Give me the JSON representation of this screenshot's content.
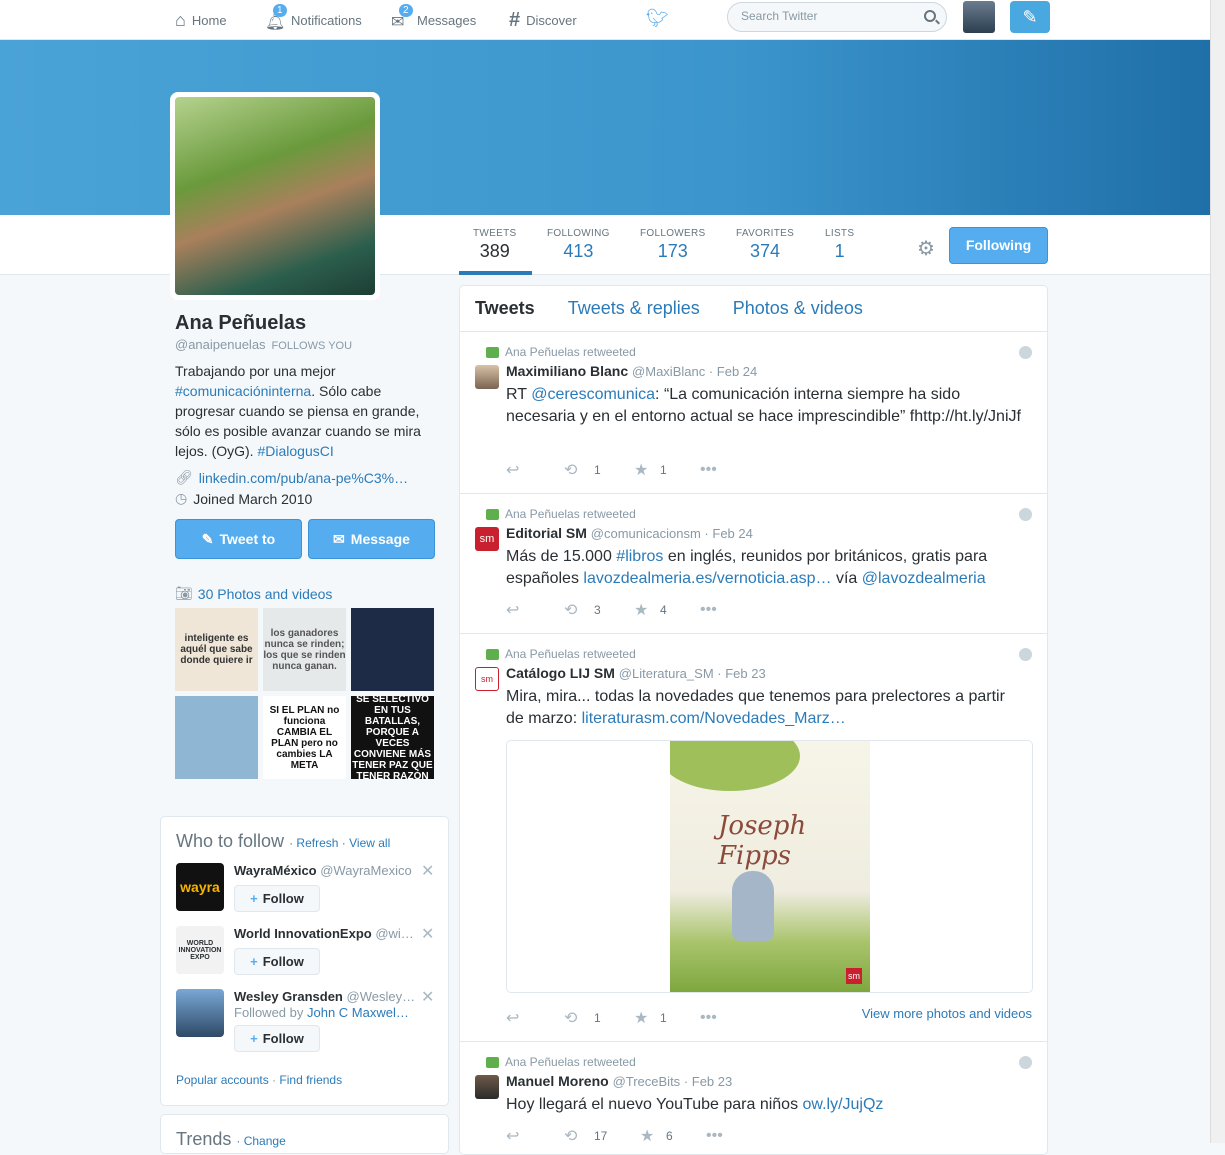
{
  "nav": {
    "home": "Home",
    "notifications": "Notifications",
    "notifications_count": "1",
    "messages": "Messages",
    "messages_count": "2",
    "discover": "Discover",
    "search_placeholder": "Search Twitter"
  },
  "stats": {
    "tweets_label": "TWEETS",
    "tweets": "389",
    "following_label": "FOLLOWING",
    "following": "413",
    "followers_label": "FOLLOWERS",
    "followers": "173",
    "favorites_label": "FAVORITES",
    "favorites": "374",
    "lists_label": "LISTS",
    "lists": "1",
    "following_button": "Following"
  },
  "profile": {
    "name": "Ana Peñuelas",
    "handle": "@anaipenuelas",
    "follows_you": "FOLLOWS YOU",
    "bio_1": "Trabajando por una mejor ",
    "bio_hashtag": "#comunicacióninterna",
    "bio_2": ". Sólo cabe progresar cuando se piensa en grande, sólo es posible avanzar cuando se mira lejos. (OyG). ",
    "bio_hashtag2": "#DialogusCI",
    "link": "linkedin.com/pub/ana-pe%C3%…",
    "joined": "Joined March 2010",
    "tweet_to": "Tweet to",
    "message": "Message",
    "photos_label": "30 Photos and videos"
  },
  "thumbs": [
    {
      "text": "inteligente es aquél que sabe donde quiere ir",
      "bg": "#efe6d8",
      "fg": "#333"
    },
    {
      "text": "los ganadores nunca se rinden; los que se rinden nunca ganan.",
      "bg": "#e6e9ea",
      "fg": "#555"
    },
    {
      "text": "",
      "bg": "#1d2b47",
      "fg": "#fff"
    },
    {
      "text": "",
      "bg": "#8fb7d4",
      "fg": "#fff"
    },
    {
      "text": "SI EL PLAN no funciona CAMBIA EL PLAN pero no cambies LA META",
      "bg": "#ffffff",
      "fg": "#111"
    },
    {
      "text": "SÉ SELECTIVO EN TUS BATALLAS, PORQUE A VECES CONVIENE MÁS TENER PAZ QUE TENER RAZÓN",
      "bg": "#111111",
      "fg": "#fff"
    }
  ],
  "who_to_follow": {
    "title": "Who to follow",
    "refresh": "Refresh",
    "view_all": "View all",
    "follow_label": "Follow",
    "items": [
      {
        "name": "WayraMéxico",
        "handle": "@WayraMexico",
        "sub": ""
      },
      {
        "name": "World InnovationExpo",
        "handle": "@wi…",
        "sub": ""
      },
      {
        "name": "Wesley Gransden",
        "handle": "@Wesley…",
        "sub_prefix": "Followed by ",
        "sub_link": "John C Maxwel…"
      }
    ],
    "popular": "Popular accounts",
    "find_friends": "Find friends"
  },
  "trends": {
    "title": "Trends",
    "change": "Change"
  },
  "tabs": {
    "tweets": "Tweets",
    "replies": "Tweets & replies",
    "photos": "Photos & videos"
  },
  "tweets": [
    {
      "retweeted_by": "Ana Peñuelas retweeted",
      "name": "Maximiliano Blanc",
      "handle": "@MaxiBlanc",
      "date": "Feb 24",
      "text_prefix": "RT ",
      "mention": "@cerescomunica",
      "text": ": “La comunicación interna siempre ha sido necesaria y en el entorno actual se hace imprescindible” fhttp://ht.ly/JniJf",
      "retweets": "1",
      "favorites": "1"
    },
    {
      "retweeted_by": "Ana Peñuelas retweeted",
      "name": "Editorial SM",
      "handle": "@comunicacionsm",
      "date": "Feb 24",
      "text_1": "Más de 15.000 ",
      "hashtag": "#libros",
      "text_2": " en inglés, reunidos por británicos, gratis para españoles ",
      "link": "lavozdealmeria.es/vernoticia.asp…",
      "text_3": " vía ",
      "mention": "@lavozdealmeria",
      "retweets": "3",
      "favorites": "4"
    },
    {
      "retweeted_by": "Ana Peñuelas retweeted",
      "name": "Catálogo LIJ SM",
      "handle": "@Literatura_SM",
      "date": "Feb 23",
      "text": "Mira, mira... todas la novedades que tenemos para prelectores a partir de marzo: ",
      "link": "literaturasm.com/Novedades_Marz…",
      "book_title": "Joseph Fipps",
      "retweets": "1",
      "favorites": "1",
      "view_more": "View more photos and videos"
    },
    {
      "retweeted_by": "Ana Peñuelas retweeted",
      "name": "Manuel Moreno",
      "handle": "@TreceBits",
      "date": "Feb 23",
      "text": "Hoy llegará el nuevo YouTube para niños ",
      "link": "ow.ly/JujQz",
      "retweets": "17",
      "favorites": "6"
    }
  ]
}
